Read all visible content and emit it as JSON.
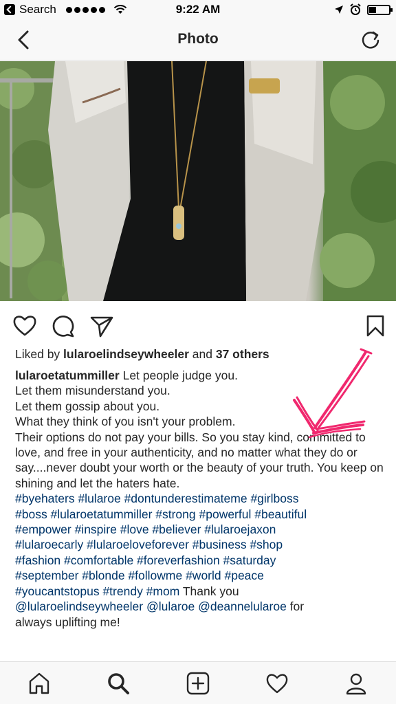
{
  "status_bar": {
    "back_app_label": "Search",
    "time": "9:22 AM",
    "icons": [
      "back-app-icon",
      "signal-dots",
      "wifi-icon",
      "location-icon",
      "alarm-icon",
      "battery-icon"
    ]
  },
  "nav": {
    "title": "Photo",
    "back_icon": "chevron-left-icon",
    "refresh_icon": "refresh-icon"
  },
  "photo": {
    "subject": "woman in light jacket and black top with long pendant necklace and gold watch"
  },
  "actions": {
    "like_icon": "heart-icon",
    "comment_icon": "comment-icon",
    "share_icon": "send-icon",
    "save_icon": "bookmark-icon"
  },
  "likes": {
    "prefix": "Liked by ",
    "user": "lularoelindseywheeler",
    "middle": " and ",
    "others": "37 others"
  },
  "caption": {
    "author": "lularoetatummiller",
    "line1": " Let people judge you.",
    "line2": "Let them misunderstand you.",
    "line3": "Let them gossip about you.",
    "line4": "What they think of you isn't your problem.",
    "paragraph": "Their options do not pay your bills. So you stay kind, committed to love, and free in your authenticity, and no matter what they do or say....never doubt your worth or the beauty of your truth. You keep on shining and let the haters hate.",
    "hashtags_l1": "#byehaters #lularoe #dontunderestimateme #girlboss",
    "hashtags_l2": "#boss #lularoetatummiller #strong #powerful #beautiful",
    "hashtags_l3": "#empower #inspire #love #believer #lularoejaxon",
    "hashtags_l4": "#lularoecarly #lularoeloveforever #business #shop",
    "hashtags_l5": "#fashion #comfortable #foreverfashion #saturday",
    "hashtags_l6": "#september #blonde #followme #world #peace",
    "hashtags_l7": "#youcantstopus #trendy #mom",
    "thanks": " Thank you",
    "mention1": "@lularoelindseywheeler",
    "mention2": "@lularoe",
    "mention3": "@deannelularoe",
    "end1": " for",
    "end2": "always uplifting me!"
  },
  "annotation": {
    "color": "#f0286e"
  },
  "tab_bar": {
    "items": [
      "home-icon",
      "search-icon",
      "add-post-icon",
      "activity-heart-icon",
      "profile-icon"
    ],
    "active": "search-icon"
  }
}
